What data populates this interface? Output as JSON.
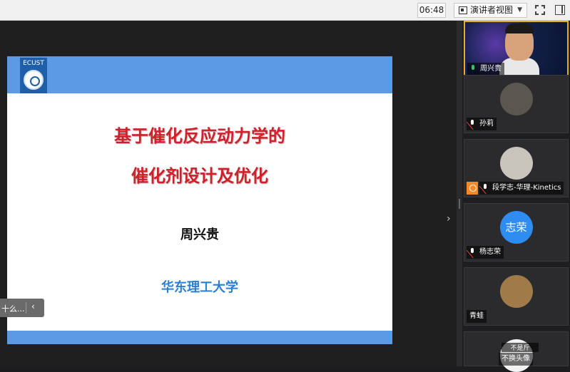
{
  "toolbar": {
    "timer": "06:48",
    "view_label": "演讲者视图"
  },
  "slide": {
    "logo_text": "ECUST",
    "title_line1": "基于催化反应动力学的",
    "title_line2": "催化剂设计及优化",
    "presenter": "周兴贵",
    "school": "华东理工大学"
  },
  "float_pill": {
    "text": "十么..."
  },
  "participants": [
    {
      "name": "周兴贵",
      "avatar": "video",
      "mic": "on"
    },
    {
      "name": "孙莉",
      "avatar": "photo",
      "mic": "muted"
    },
    {
      "name": "段学志-华理-Kinetics",
      "avatar": "photo",
      "mic": "muted",
      "host": true
    },
    {
      "name": "杨志荣",
      "avatar": "text",
      "avatar_text": "志荣",
      "mic": "muted"
    },
    {
      "name": "青蛙",
      "avatar": "photo",
      "mic": "none"
    },
    {
      "name": "不换头像",
      "avatar": "photo",
      "overlay": "不是斤"
    }
  ],
  "colors": {
    "accent_blue": "#5b9be6",
    "title_red": "#d0202a",
    "school_blue": "#2a7fd4",
    "active_speaker": "#e0b020"
  }
}
